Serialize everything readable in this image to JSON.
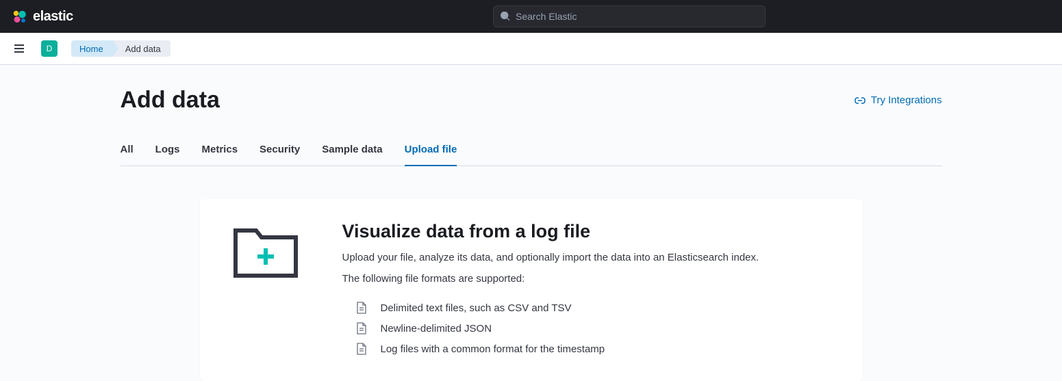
{
  "header": {
    "logo_text": "elastic",
    "search_placeholder": "Search Elastic",
    "avatar_letter": "D"
  },
  "breadcrumb": {
    "items": [
      "Home",
      "Add data"
    ]
  },
  "page": {
    "title": "Add data",
    "try_integrations_label": "Try Integrations"
  },
  "tabs": {
    "items": [
      "All",
      "Logs",
      "Metrics",
      "Security",
      "Sample data",
      "Upload file"
    ],
    "active_index": 5
  },
  "card": {
    "title": "Visualize data from a log file",
    "description": "Upload your file, analyze its data, and optionally import the data into an Elasticsearch index.",
    "subtext": "The following file formats are supported:",
    "formats": [
      "Delimited text files, such as CSV and TSV",
      "Newline-delimited JSON",
      "Log files with a common format for the timestamp"
    ]
  }
}
